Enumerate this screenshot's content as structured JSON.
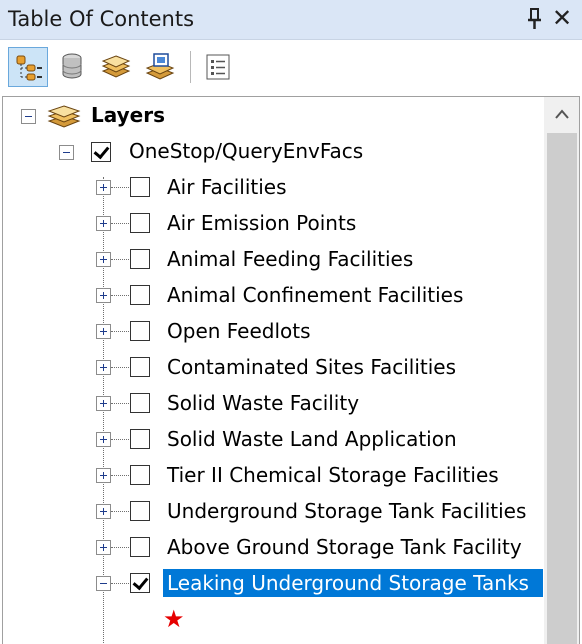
{
  "panel": {
    "title": "Table Of Contents",
    "close_glyph": "✕",
    "pin_icon": "pin-icon"
  },
  "toolbar": {
    "buttons": [
      {
        "name": "list-by-drawing-order",
        "icon": "drawing-order-icon",
        "active": true
      },
      {
        "name": "list-by-source",
        "icon": "source-database-icon",
        "active": false
      },
      {
        "name": "list-by-visibility",
        "icon": "layers-visibility-icon",
        "active": false
      },
      {
        "name": "list-by-selection",
        "icon": "selection-icon",
        "active": false
      },
      {
        "name": "options",
        "icon": "options-list-icon",
        "active": false
      }
    ]
  },
  "tree": {
    "root": {
      "label": "Layers",
      "icon": "layers-stack-icon",
      "expanded": true
    },
    "group": {
      "label": "OneStop/QueryEnvFacs",
      "checked": true,
      "expanded": true
    },
    "layers": [
      {
        "label": "Air Facilities",
        "checked": false,
        "expanded": false,
        "selected": false
      },
      {
        "label": "Air Emission Points",
        "checked": false,
        "expanded": false,
        "selected": false
      },
      {
        "label": "Animal Feeding Facilities",
        "checked": false,
        "expanded": false,
        "selected": false
      },
      {
        "label": "Animal Confinement Facilities",
        "checked": false,
        "expanded": false,
        "selected": false
      },
      {
        "label": "Open Feedlots",
        "checked": false,
        "expanded": false,
        "selected": false
      },
      {
        "label": "Contaminated Sites Facilities",
        "checked": false,
        "expanded": false,
        "selected": false
      },
      {
        "label": "Solid Waste Facility",
        "checked": false,
        "expanded": false,
        "selected": false
      },
      {
        "label": "Solid Waste Land Application",
        "checked": false,
        "expanded": false,
        "selected": false
      },
      {
        "label": "Tier II Chemical Storage Facilities",
        "checked": false,
        "expanded": false,
        "selected": false
      },
      {
        "label": "Underground Storage Tank Facilities",
        "checked": false,
        "expanded": false,
        "selected": false
      },
      {
        "label": "Above Ground Storage Tank Facility",
        "checked": false,
        "expanded": false,
        "selected": false
      },
      {
        "label": "Leaking Underground Storage Tanks",
        "checked": true,
        "expanded": true,
        "selected": true
      }
    ],
    "symbol": {
      "glyph": "★",
      "color": "#e60000"
    }
  },
  "colors": {
    "titlebar": "#dae6f6",
    "selection": "#0078d7",
    "scrollbar_track": "#f0f0f0",
    "scrollbar_thumb": "#cdcdcd"
  }
}
